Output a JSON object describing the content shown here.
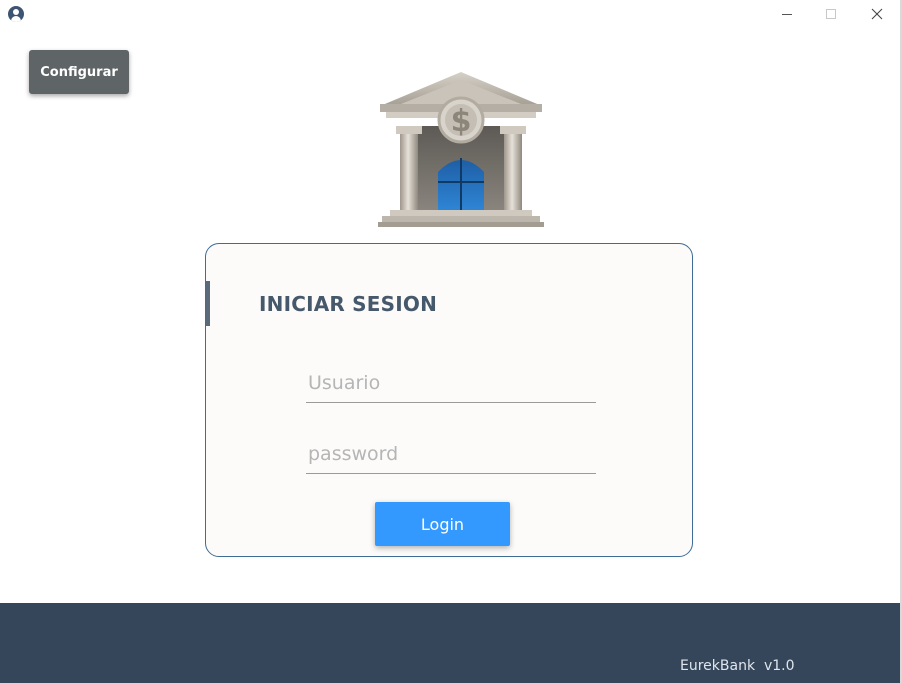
{
  "titlebar": {
    "app_icon": "user-circle-icon",
    "controls": [
      "minimize-icon",
      "maximize-icon",
      "close-icon"
    ]
  },
  "toolbar": {
    "config_label": "Configurar"
  },
  "logo": {
    "icon": "bank-building-icon"
  },
  "login": {
    "title": "INICIAR SESION",
    "user_placeholder": "Usuario",
    "user_value": "",
    "password_placeholder": "password",
    "password_value": "",
    "button_label": "Login"
  },
  "footer": {
    "app_name": "EurekBank",
    "version": "v1.0"
  },
  "colors": {
    "accent": "#3399ff",
    "footer_bg": "#35465b",
    "config_bg": "#5f6567",
    "card_border": "#3e6d96",
    "title_color": "#46586b"
  }
}
